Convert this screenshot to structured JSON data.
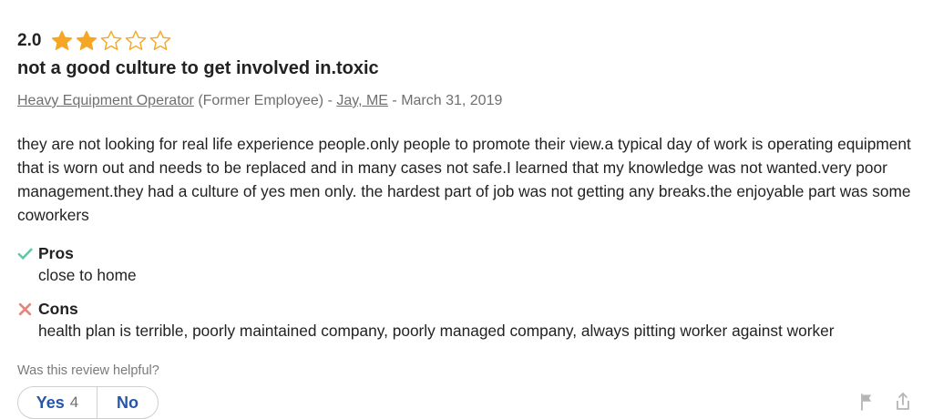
{
  "review": {
    "rating": "2.0",
    "stars": [
      {
        "icon": "star-filled-icon",
        "fill": 1
      },
      {
        "icon": "star-filled-icon",
        "fill": 1
      },
      {
        "icon": "star-empty-icon",
        "fill": 0
      },
      {
        "icon": "star-empty-icon",
        "fill": 0
      },
      {
        "icon": "star-empty-icon",
        "fill": 0
      }
    ],
    "title": "not a good culture to get involved in.toxic",
    "job_title": "Heavy Equipment Operator",
    "employment_status": "(Former Employee)",
    "separator": " - ",
    "location": "Jay, ME",
    "date": "March 31, 2019",
    "text": "they are not looking for real life experience people.only people to promote their view.a typical day of work is operating equipment that is worn out and needs to be replaced and in many cases not safe.I learned that my knowledge was not wanted.very poor management.they had a culture of yes men only. the hardest part of job was not getting any breaks.the enjoyable part was some coworkers",
    "pros": {
      "label": "Pros",
      "icon": "checkmark-icon",
      "text": "close to home"
    },
    "cons": {
      "label": "Cons",
      "icon": "x-mark-icon",
      "text": "health plan is terrible, poorly maintained company, poorly managed company, always pitting worker against worker"
    }
  },
  "helpful": {
    "question": "Was this review helpful?",
    "yes_label": "Yes",
    "yes_count": "4",
    "no_label": "No"
  },
  "actions": {
    "flag_icon": "flag-icon",
    "share_icon": "share-icon"
  },
  "colors": {
    "star": "#f5a623",
    "link": "#2557a7",
    "pros_check": "#5ec7a3",
    "cons_x": "#e8857a",
    "muted_text": "#6f6f6f"
  }
}
